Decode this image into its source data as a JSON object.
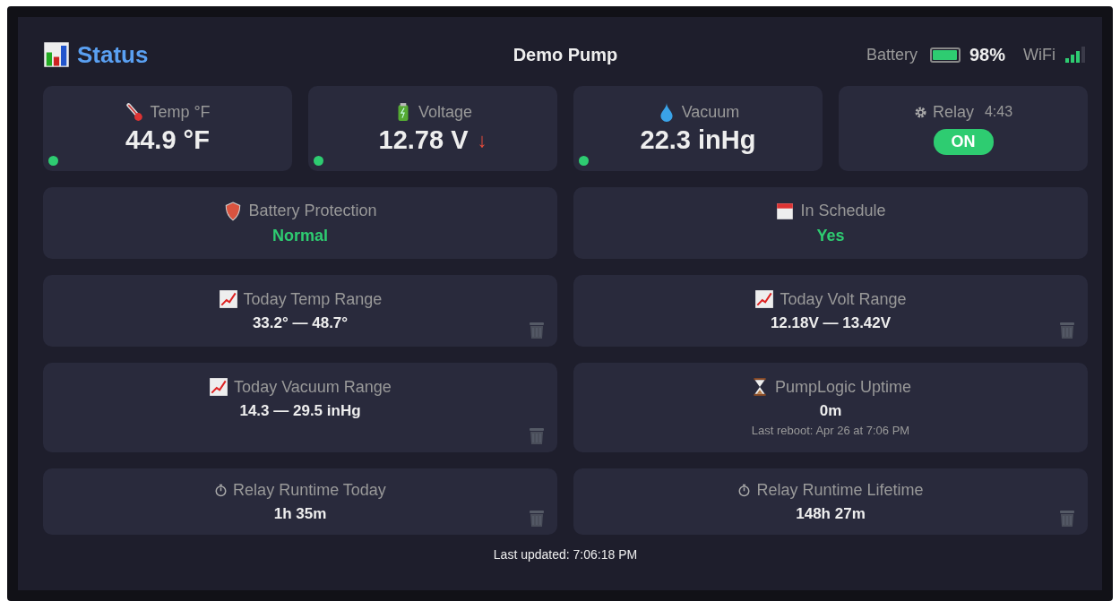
{
  "header": {
    "title": "Status",
    "device": "Demo Pump",
    "battery_label": "Battery",
    "battery": {
      "level": 0.98
    },
    "battery_percent": "98%",
    "wifi_label": "WiFi"
  },
  "top_cards": [
    {
      "kind": "thermometer",
      "label": "Temp °F",
      "value": "44.9 °F",
      "color": "#2ecc71"
    },
    {
      "kind": "battery",
      "label": "Voltage",
      "value": "12.78 V",
      "trend": "↓",
      "color": "#2ecc71"
    },
    {
      "kind": "drop",
      "label": "Vacuum",
      "value": "22.3 inHg",
      "color": "#2ecc71"
    },
    {
      "kind": "relay",
      "label": "Relay",
      "timer": "4:43",
      "on": true,
      "state": "ON"
    }
  ],
  "cards": [
    {
      "kind": "shield",
      "label": "Battery Protection",
      "value": "Normal",
      "ok": true,
      "resettable": false
    },
    {
      "kind": "calendar",
      "label": "In Schedule",
      "value": "Yes",
      "ok": true,
      "resettable": false
    },
    {
      "kind": "chart",
      "label": "Today Temp Range",
      "value": "33.2° — 48.7°",
      "resettable": true
    },
    {
      "kind": "chart",
      "label": "Today Volt Range",
      "value": "12.18V — 13.42V",
      "resettable": true
    },
    {
      "kind": "chart",
      "label": "Today Vacuum Range",
      "value": "14.3 — 29.5 inHg",
      "resettable": true
    },
    {
      "kind": "hourglass",
      "label": "PumpLogic Uptime",
      "value": "0m",
      "note": "Last reboot: Apr 26 at 7:06 PM",
      "resettable": false
    },
    {
      "kind": "stopwatch",
      "label": "Relay Runtime Today",
      "value": "1h 35m",
      "resettable": true
    },
    {
      "kind": "stopwatch",
      "label": "Relay Runtime Lifetime",
      "value": "148h 27m",
      "resettable": true
    }
  ],
  "footer": "Last updated: 7:06:18 PM"
}
